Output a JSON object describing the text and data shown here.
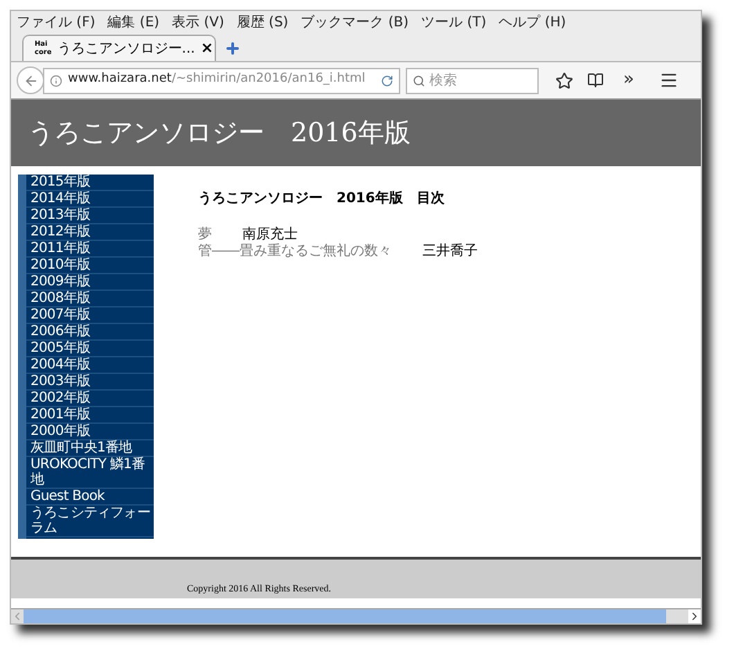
{
  "menu": [
    "ファイル (F)",
    "編集 (E)",
    "表示 (V)",
    "履歴 (S)",
    "ブックマーク (B)",
    "ツール (T)",
    "ヘルプ (H)"
  ],
  "tabs": [
    {
      "favicon": "Hai\ncore",
      "label": "うろこアンソロジー...",
      "selected": true,
      "close": "×"
    }
  ],
  "nav": {
    "url_host": "www.haizara.net",
    "url_path": "/~shimirin/an2016/an16_i.html",
    "search_placeholder": "検索",
    "overflow": "»"
  },
  "header": {
    "title": "うろこアンソロジー　2016年版"
  },
  "sidebar": [
    "2015年版",
    "2014年版",
    "2013年版",
    "2012年版",
    "2011年版",
    "2010年版",
    "2009年版",
    "2008年版",
    "2007年版",
    "2006年版",
    "2005年版",
    "2004年版",
    "2003年版",
    "2002年版",
    "2001年版",
    "2000年版",
    "灰皿町中央1番地",
    "UROKOCITY 鱗1番地",
    "Guest Book",
    "うろこシティフォーラム"
  ],
  "content": {
    "heading": "うろこアンソロジー　2016年版　目次",
    "entries": [
      {
        "title": "夢",
        "author": "南原充士"
      },
      {
        "title": "管――畳み重なるご無礼の数々",
        "author": "三井喬子"
      }
    ]
  },
  "footer": {
    "copyright": "Copyright 2016 All Rights Reserved."
  }
}
